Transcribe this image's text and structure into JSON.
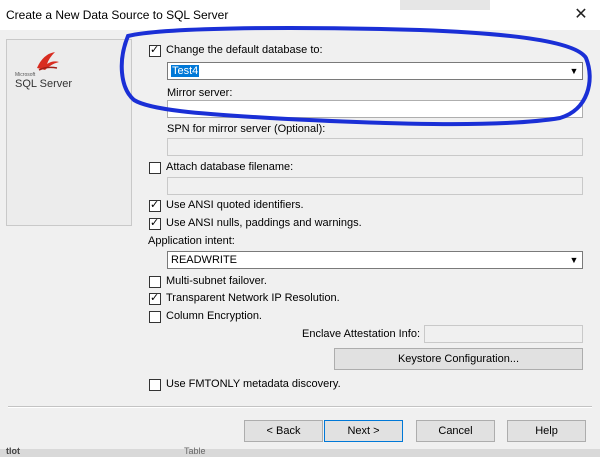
{
  "window": {
    "title": "Create a New Data Source to SQL Server",
    "close_glyph": "✕"
  },
  "logo": {
    "small_text": "Microsoft",
    "brand": "SQL Server"
  },
  "options": {
    "change_default_db": {
      "label": "Change the default database to:",
      "checked": true
    },
    "database_value": "Test4",
    "mirror_server_label": "Mirror server:",
    "spn_label": "SPN for mirror server (Optional):",
    "attach_db": {
      "label": "Attach database filename:",
      "checked": false
    },
    "ansi_quoted": {
      "label": "Use ANSI quoted identifiers.",
      "checked": true
    },
    "ansi_nulls": {
      "label": "Use ANSI nulls, paddings and warnings.",
      "checked": true
    },
    "application_intent_label": "Application intent:",
    "application_intent_value": "READWRITE",
    "multi_subnet": {
      "label": "Multi-subnet failover.",
      "checked": false
    },
    "transparent_ip": {
      "label": "Transparent Network IP Resolution.",
      "checked": true
    },
    "column_encryption": {
      "label": "Column Encryption.",
      "checked": false
    },
    "enclave_label": "Enclave Attestation Info:",
    "keystore_button": "Keystore Configuration...",
    "fmtonly": {
      "label": "Use FMTONLY metadata discovery.",
      "checked": false
    }
  },
  "buttons": {
    "back": "< Back",
    "next": "Next >",
    "cancel": "Cancel",
    "help": "Help"
  },
  "background": {
    "left_text": "tlot",
    "right_text": "Table"
  },
  "annotation": {
    "color": "#1a2fd6"
  }
}
